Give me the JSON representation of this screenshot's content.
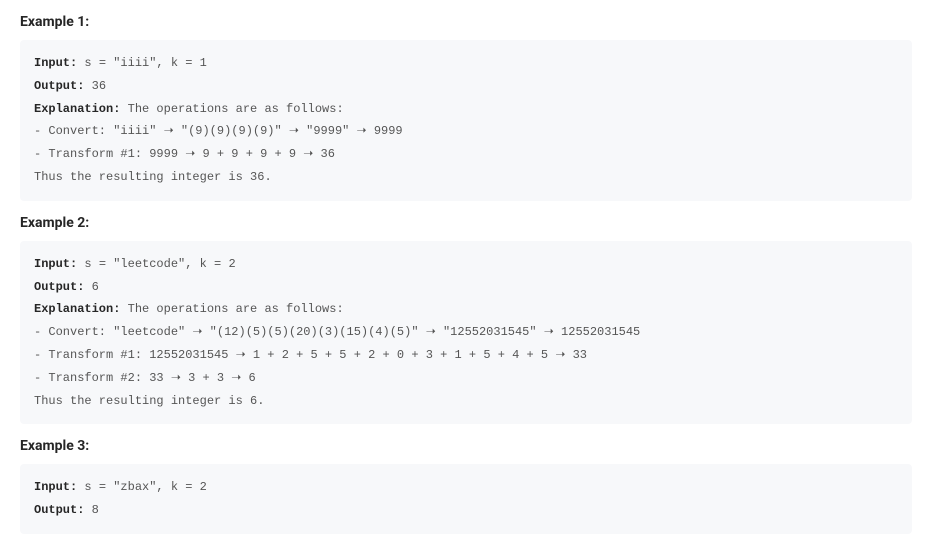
{
  "examples": [
    {
      "heading": "Example 1:",
      "input_label": "Input:",
      "input_value": " s = \"iiii\", k = 1",
      "output_label": "Output:",
      "output_value": " 36",
      "explanation_label": "Explanation:",
      "explanation_intro": " The operations are as follows:",
      "lines": [
        "- Convert: \"iiii\" ➝ \"(9)(9)(9)(9)\" ➝ \"9999\" ➝ 9999",
        "- Transform #1: 9999 ➝ 9 + 9 + 9 + 9 ➝ 36",
        "Thus the resulting integer is 36."
      ]
    },
    {
      "heading": "Example 2:",
      "input_label": "Input:",
      "input_value": " s = \"leetcode\", k = 2",
      "output_label": "Output:",
      "output_value": " 6",
      "explanation_label": "Explanation:",
      "explanation_intro": " The operations are as follows:",
      "lines": [
        "- Convert: \"leetcode\" ➝ \"(12)(5)(5)(20)(3)(15)(4)(5)\" ➝ \"12552031545\" ➝ 12552031545",
        "- Transform #1: 12552031545 ➝ 1 + 2 + 5 + 5 + 2 + 0 + 3 + 1 + 5 + 4 + 5 ➝ 33",
        "- Transform #2: 33 ➝ 3 + 3 ➝ 6",
        "Thus the resulting integer is 6."
      ]
    },
    {
      "heading": "Example 3:",
      "input_label": "Input:",
      "input_value": " s = \"zbax\", k = 2",
      "output_label": "Output:",
      "output_value": " 8",
      "explanation_label": "",
      "explanation_intro": "",
      "lines": []
    }
  ]
}
